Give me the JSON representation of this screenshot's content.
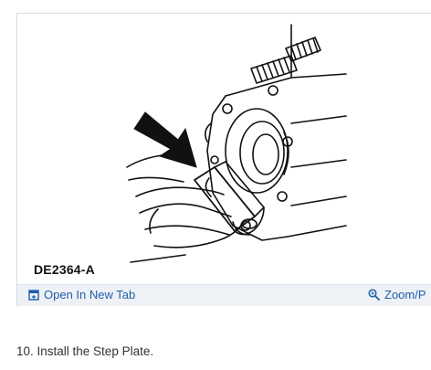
{
  "figure": {
    "code": "DE2364-A"
  },
  "toolbar": {
    "open_tab_label": "Open In New Tab",
    "open_tab_icon": "open-new-tab-icon",
    "zoom_label": "Zoom/P",
    "zoom_icon": "magnifier-icon",
    "link_color": "#1f5fa8"
  },
  "instruction": {
    "text": "10. Install the Step Plate."
  }
}
